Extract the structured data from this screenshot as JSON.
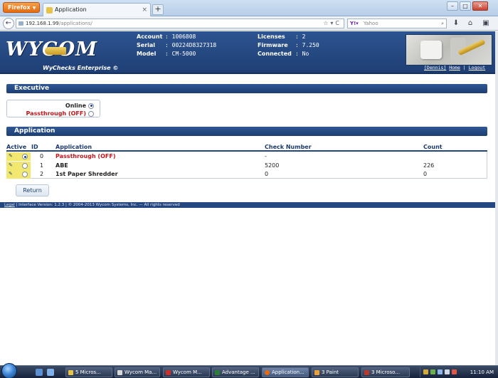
{
  "browser": {
    "menu_button": "Firefox",
    "tab_title": "Application",
    "url_host": "192.168.1.99",
    "url_path": "/applications/",
    "search_placeholder": "Yahoo",
    "new_tab": "+"
  },
  "header": {
    "logo_text": "WYCOM",
    "tagline": "WyChecks Enterprise",
    "account_label": "Account",
    "account_value": ": 1006808",
    "serial_label": "Serial",
    "serial_value": ": 00224D8327318",
    "model_label": "Model",
    "model_value": ": CM-5000",
    "licenses_label": "Licenses",
    "licenses_value": ": 2",
    "firmware_label": "Firmware",
    "firmware_value": ": 7.250",
    "connected_label": "Connected",
    "connected_value": ": No",
    "user": "[Dennis]",
    "home_link": "Home",
    "logout_link": "Logout"
  },
  "executive": {
    "title": "Executive",
    "options": [
      {
        "label": "Online",
        "selected": true
      },
      {
        "label": "Passthrough (OFF)",
        "selected": false
      }
    ]
  },
  "application": {
    "title": "Application",
    "columns": [
      "Active",
      "ID",
      "Application",
      "Check Number",
      "Count"
    ],
    "rows": [
      {
        "id": "0",
        "name": "Passthrough (OFF)",
        "check": "-",
        "count": "",
        "active": true
      },
      {
        "id": "1",
        "name": "ABE",
        "check": "5200",
        "count": "226",
        "active": false
      },
      {
        "id": "2",
        "name": "1st Paper Shredder",
        "check": "0",
        "count": "0",
        "active": false
      }
    ],
    "return_button": "Return"
  },
  "footer": {
    "legal": "Legal",
    "text": " | Interface Version: 1.2.3 | © 2004-2013 Wycom Systems, Inc. — All rights reserved"
  },
  "taskbar": {
    "items": [
      "5 Micros...",
      "Wycom Ma...",
      "Wycom M...",
      "Advantage ...",
      "Application...",
      "3 Paint",
      "3 Microso..."
    ],
    "clock": "11:10 AM"
  },
  "colors": {
    "header_blue": "#1f3f74",
    "off_red": "#c0181c",
    "active_yellow": "#f3e86f"
  }
}
